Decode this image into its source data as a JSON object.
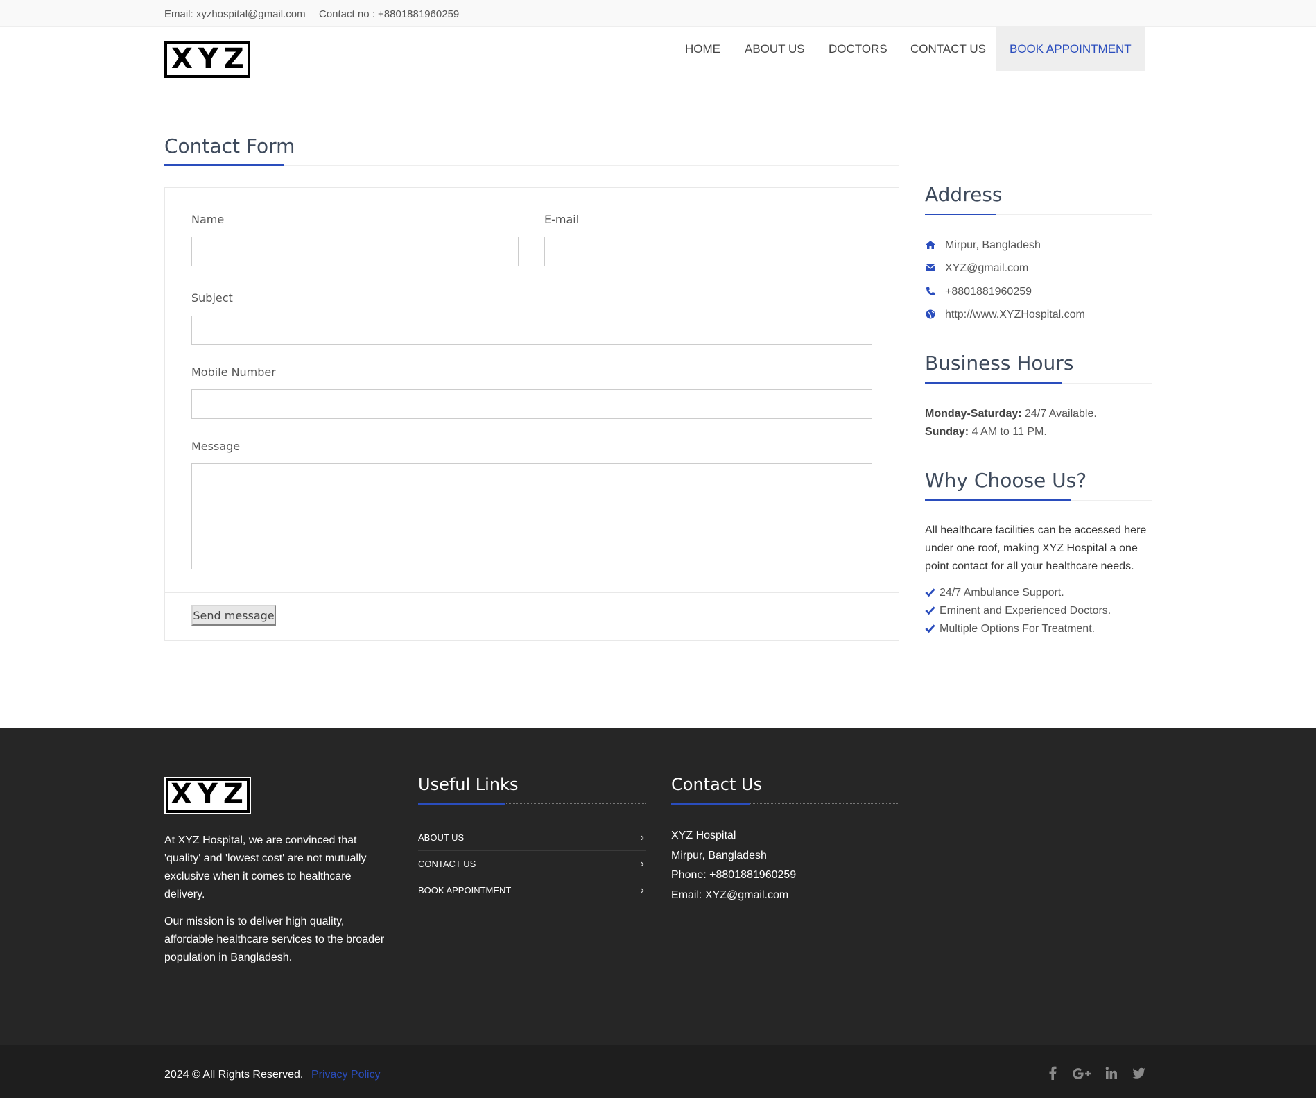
{
  "topbar": {
    "email": "Email: xyzhospital@gmail.com",
    "contact": "Contact no : +8801881960259"
  },
  "header": {
    "logo_text": "XYZ",
    "nav": [
      "HOME",
      "ABOUT US",
      "DOCTORS",
      "CONTACT US",
      "BOOK APPOINTMENT"
    ]
  },
  "contact_form": {
    "title": "Contact Form",
    "name_label": "Name",
    "email_label": "E-mail",
    "subject_label": "Subject",
    "mobile_label": "Mobile Number",
    "message_label": "Message",
    "name_value": "",
    "email_value": "",
    "subject_value": "",
    "mobile_value": "",
    "message_value": "",
    "send_label": "Send message"
  },
  "address": {
    "title": "Address",
    "location": "Mirpur, Bangladesh",
    "email": "XYZ@gmail.com",
    "phone": "+8801881960259",
    "website": "http://www.XYZHospital.com",
    "icons": [
      "home-icon",
      "envelope-icon",
      "phone-icon",
      "globe-icon"
    ]
  },
  "business_hours": {
    "title": "Business Hours",
    "weekday_label": "Monday-Saturday:",
    "weekday_value": " 24/7 Available.",
    "sunday_label": "Sunday:",
    "sunday_value": " 4 AM to 11 PM."
  },
  "why_choose": {
    "title": "Why Choose Us?",
    "paragraph": "All healthcare facilities can be accessed here under one roof, making XYZ Hospital a one point contact for all your healthcare needs.",
    "items": [
      "24/7 Ambulance Support.",
      "Eminent and Experienced Doctors.",
      "Multiple Options For Treatment."
    ]
  },
  "footer": {
    "logo_text": "XYZ",
    "para1": "At XYZ Hospital, we are convinced that 'quality' and 'lowest cost' are not mutually exclusive when it comes to healthcare delivery.",
    "para2": "Our mission is to deliver high quality, affordable healthcare services to the broader population in Bangladesh.",
    "useful_links_title": "Useful Links",
    "useful_links": [
      "ABOUT US",
      "CONTACT US",
      "BOOK APPOINTMENT"
    ],
    "contact_title": "Contact Us",
    "contact_name": "XYZ Hospital",
    "contact_location": "Mirpur, Bangladesh",
    "contact_phone": "Phone: +8801881960259",
    "contact_email": "Email: XYZ@gmail.com"
  },
  "bottom": {
    "copyright": "2024 © All Rights Reserved.",
    "privacy": "Privacy Policy",
    "social_icons": [
      "facebook-icon",
      "google-plus-icon",
      "linkedin-icon",
      "twitter-icon"
    ]
  },
  "colors": {
    "accent": "#2a4dbd",
    "footer_bg": "#262626",
    "bottom_bg": "#1e1e1e"
  }
}
